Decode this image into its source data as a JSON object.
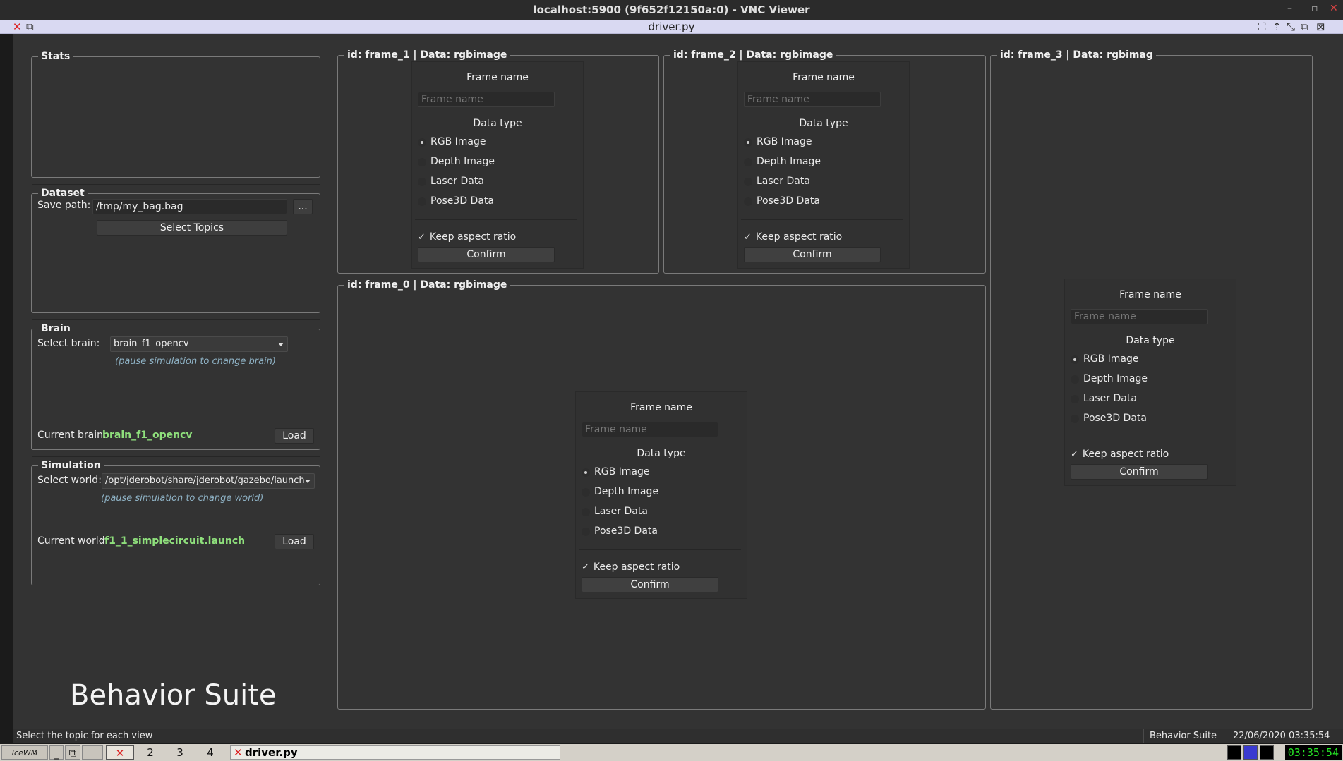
{
  "vnc": {
    "title": "localhost:5900 (9f652f12150a:0) - VNC Viewer",
    "minimize_icon": "minimize-icon",
    "restore_icon": "restore-icon",
    "close_icon": "close-icon"
  },
  "window": {
    "title": "driver.py"
  },
  "stats": {
    "title": "Stats"
  },
  "dataset": {
    "title": "Dataset",
    "save_path_label": "Save path:",
    "save_path_value": "/tmp/my_bag.bag",
    "browse_label": "...",
    "select_topics_label": "Select Topics"
  },
  "brain": {
    "title": "Brain",
    "select_label": "Select brain:",
    "selected": "brain_f1_opencv",
    "hint": "(pause simulation to change brain)",
    "current_label": "Current brain:",
    "current_value": "brain_f1_opencv",
    "load_label": "Load"
  },
  "simulation": {
    "title": "Simulation",
    "select_label": "Select world:",
    "selected": "/opt/jderobot/share/jderobot/gazebo/launch",
    "hint": "(pause simulation to change world)",
    "current_label": "Current world:",
    "current_value": "f1_1_simplecircuit.launch",
    "load_label": "Load"
  },
  "frame_form": {
    "frame_name_title": "Frame name",
    "frame_name_placeholder": "Frame name",
    "data_type_title": "Data type",
    "options": [
      "RGB Image",
      "Depth Image",
      "Laser Data",
      "Pose3D Data"
    ],
    "selected_option": "RGB Image",
    "keep_aspect_label": "Keep aspect ratio",
    "keep_aspect_checked": true,
    "checkmark": "✓",
    "confirm_label": "Confirm"
  },
  "frames": {
    "frame_1": "id:  frame_1 | Data:  rgbimage",
    "frame_2": "id:  frame_2 | Data:  rgbimage",
    "frame_3": "id:  frame_3 | Data:  rgbimag",
    "frame_0": "id:  frame_0 | Data:  rgbimage"
  },
  "branding": {
    "suite_title": "Behavior Suite"
  },
  "statusbar": {
    "message": "Select the topic for each view",
    "app_name": "Behavior Suite",
    "datetime": "22/06/2020 03:35:54"
  },
  "taskbar": {
    "workspaces": [
      "2",
      "3",
      "4"
    ],
    "active_task": "driver.py",
    "clock": "03:35:54"
  },
  "colors": {
    "app_bg": "#333333",
    "green_value": "#8fe07c",
    "hint_text": "#8fb3c6",
    "clock_text": "#26e626"
  }
}
